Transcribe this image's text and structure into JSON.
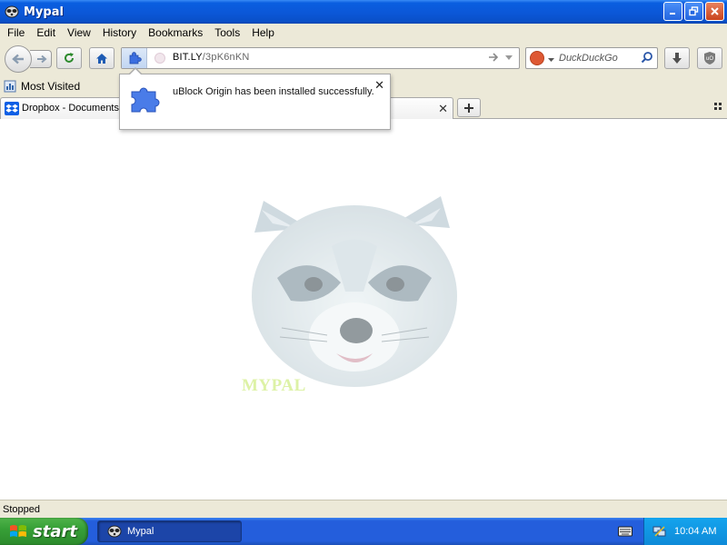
{
  "window": {
    "title": "Mypal"
  },
  "menu": [
    "File",
    "Edit",
    "View",
    "History",
    "Bookmarks",
    "Tools",
    "Help"
  ],
  "navigation": {
    "url_host": "BIT.LY",
    "url_path": "/3pK6nKN",
    "search_placeholder": "DuckDuckGo"
  },
  "bookmarks": {
    "most_visited": "Most Visited"
  },
  "tabs": [
    {
      "label": "Dropbox - Documents -"
    }
  ],
  "notification": {
    "message": "uBlock Origin has been installed successfully."
  },
  "content": {
    "watermark": "MYPAL"
  },
  "status": {
    "text": "Stopped"
  },
  "taskbar": {
    "start_label": "start",
    "task_item": "Mypal",
    "clock": "10:04 AM"
  },
  "colors": {
    "titlebar": "#0b57d8",
    "chrome": "#ece9d8",
    "taskbar": "#245edc",
    "start": "#37a037",
    "tray": "#0e8ad8"
  }
}
